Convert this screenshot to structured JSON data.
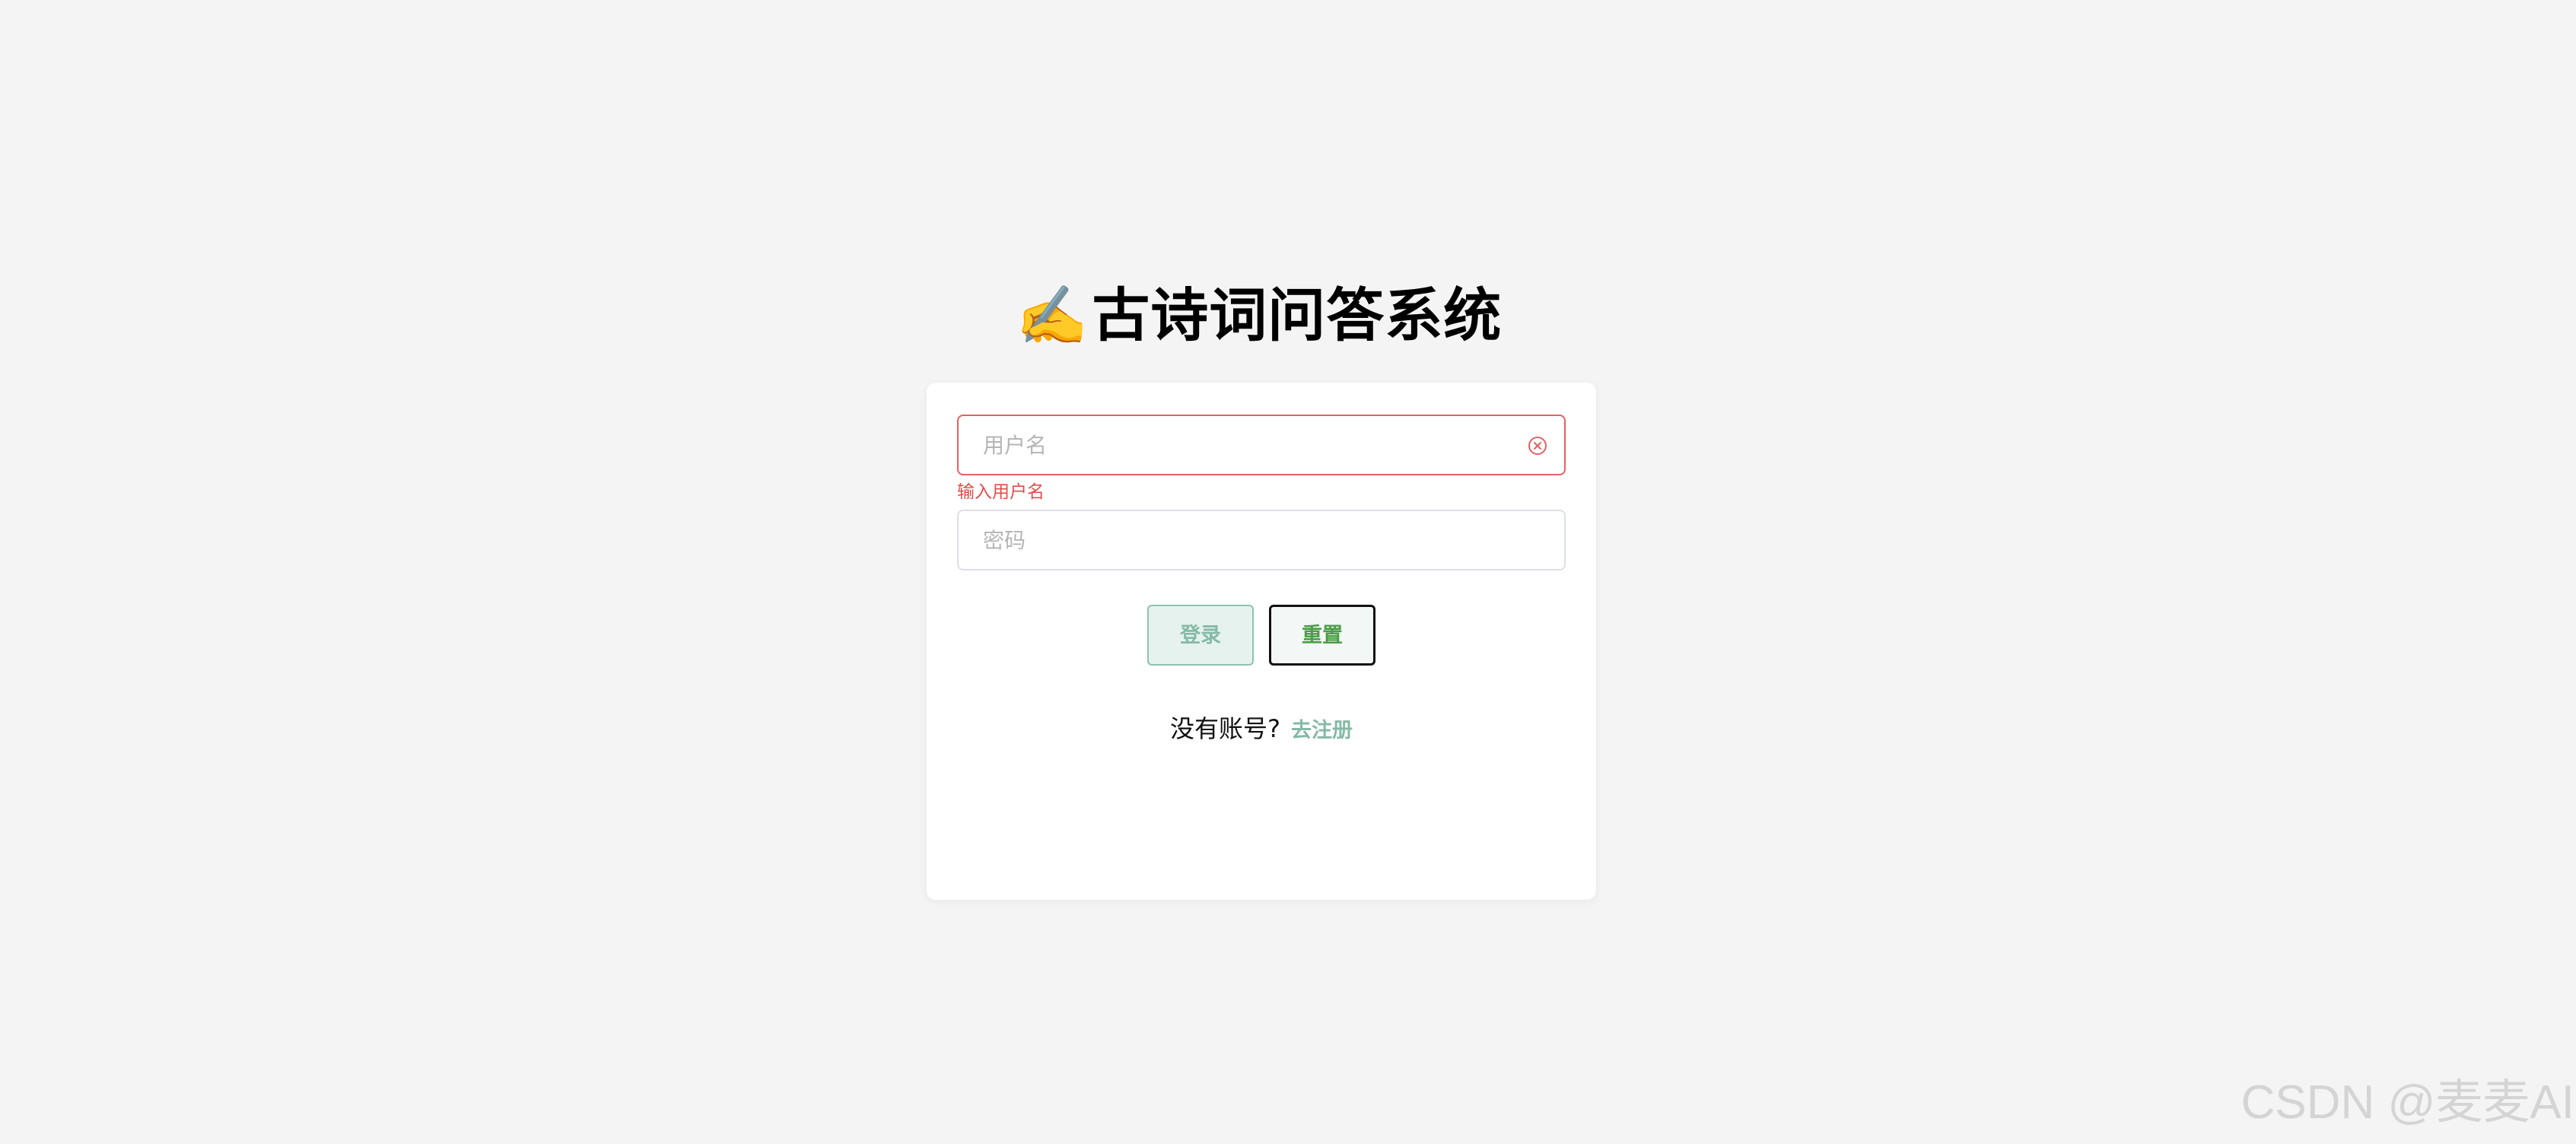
{
  "header": {
    "emoji": "✍️",
    "title": "古诗词问答系统"
  },
  "login_form": {
    "username": {
      "placeholder": "用户名",
      "value": "",
      "error": "输入用户名",
      "clear_icon": "circle-x-icon"
    },
    "password": {
      "placeholder": "密码",
      "value": ""
    },
    "buttons": {
      "login_label": "登录",
      "reset_label": "重置"
    },
    "register": {
      "question": "没有账号?",
      "link_label": "去注册"
    }
  },
  "watermark": "CSDN @麦麦AI",
  "colors": {
    "background": "#f4f4f4",
    "error": "#e24c4c",
    "accent": "#86b9a6",
    "reset_text": "#4a9e46"
  }
}
